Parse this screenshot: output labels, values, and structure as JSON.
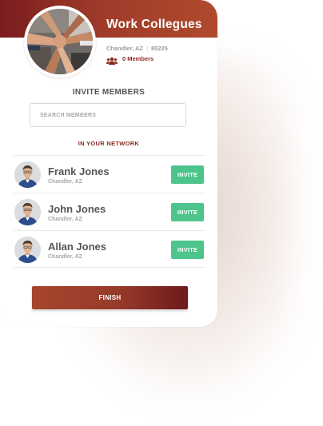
{
  "group": {
    "title": "Work Collegues",
    "city": "Chandler, AZ",
    "separator": "|",
    "zip": "85225",
    "members_label": "0 Members",
    "members_icon": "users-icon",
    "photo": "group-hands-photo"
  },
  "invite": {
    "heading": "INVITE MEMBERS",
    "search_placeholder": "SEARCH MEMBERS",
    "network_heading": "IN YOUR NETWORK"
  },
  "contacts": [
    {
      "name": "Frank Jones",
      "location": "Chandler, AZ",
      "button": "INVITE"
    },
    {
      "name": "John Jones",
      "location": "Chandler, AZ",
      "button": "INVITE"
    },
    {
      "name": "Allan Jones",
      "location": "Chandler, AZ",
      "button": "INVITE"
    }
  ],
  "finish_label": "FINISH",
  "colors": {
    "header_start": "#7a1c1e",
    "header_end": "#b04a2e",
    "invite_green": "#4cc48b",
    "accent_red": "#8b2a22"
  }
}
